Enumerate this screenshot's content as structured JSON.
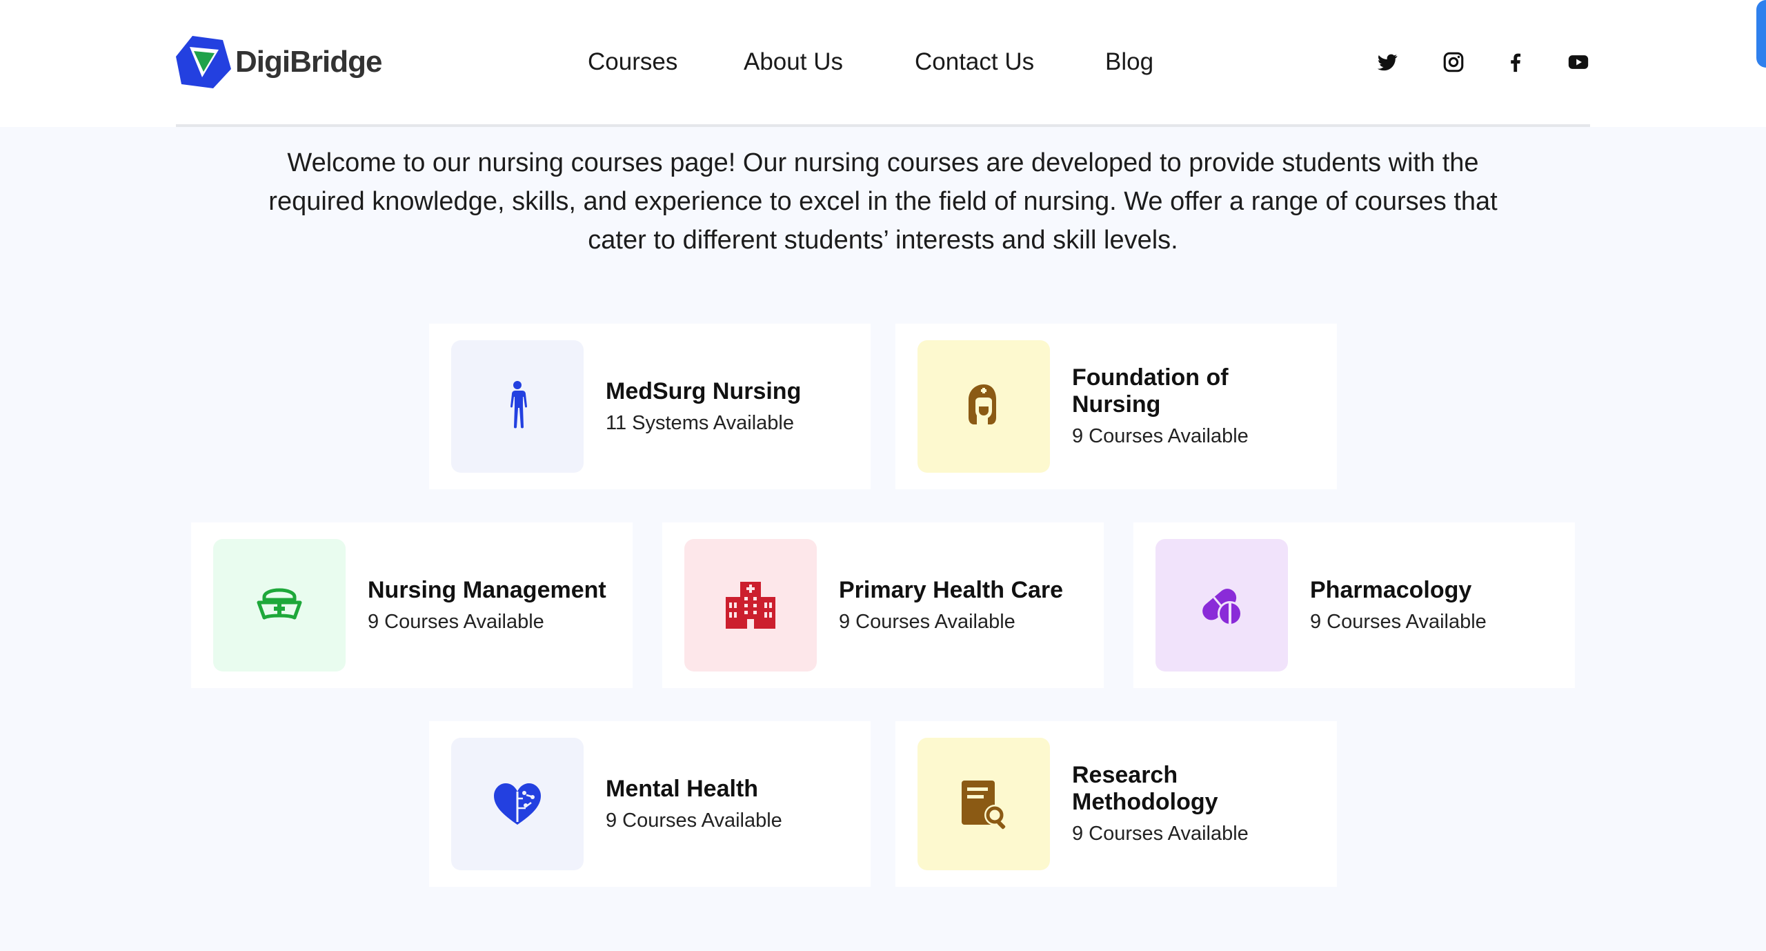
{
  "brand": {
    "name": "DigiBridge"
  },
  "nav": {
    "items": [
      "Courses",
      "About Us",
      "Contact Us",
      "Blog"
    ]
  },
  "social": [
    "twitter-icon",
    "instagram-icon",
    "facebook-icon",
    "youtube-icon"
  ],
  "intro": "Welcome to our nursing courses page! Our nursing courses are developed to provide students with the required knowledge, skills, and experience to excel in the field of nursing. We offer a range of courses that cater to different students’ interests and skill levels.",
  "courses": [
    {
      "title": "MedSurg Nursing",
      "subtitle": "11 Systems Available",
      "icon": "human-body-icon",
      "bg": "#f1f3fc",
      "color": "#2340e0"
    },
    {
      "title": "Foundation of Nursing",
      "subtitle": "9 Courses Available",
      "icon": "nurse-icon",
      "bg": "#fdf9cf",
      "color": "#8b5a14"
    },
    {
      "title": "Nursing Management",
      "subtitle": "9 Courses Available",
      "icon": "nurse-cap-icon",
      "bg": "#e9fcef",
      "color": "#1ea83a"
    },
    {
      "title": "Primary Health Care",
      "subtitle": "9 Courses Available",
      "icon": "hospital-icon",
      "bg": "#fde7ea",
      "color": "#cc1f2e"
    },
    {
      "title": "Pharmacology",
      "subtitle": "9 Courses Available",
      "icon": "pills-icon",
      "bg": "#f1e3fb",
      "color": "#8a2bd8"
    },
    {
      "title": "Mental Health",
      "subtitle": "9 Courses Available",
      "icon": "brain-heart-icon",
      "bg": "#f1f3fc",
      "color": "#2340e0"
    },
    {
      "title": "Research Methodology",
      "subtitle": "9 Courses Available",
      "icon": "research-document-icon",
      "bg": "#fdf9cf",
      "color": "#8b5a14"
    }
  ]
}
